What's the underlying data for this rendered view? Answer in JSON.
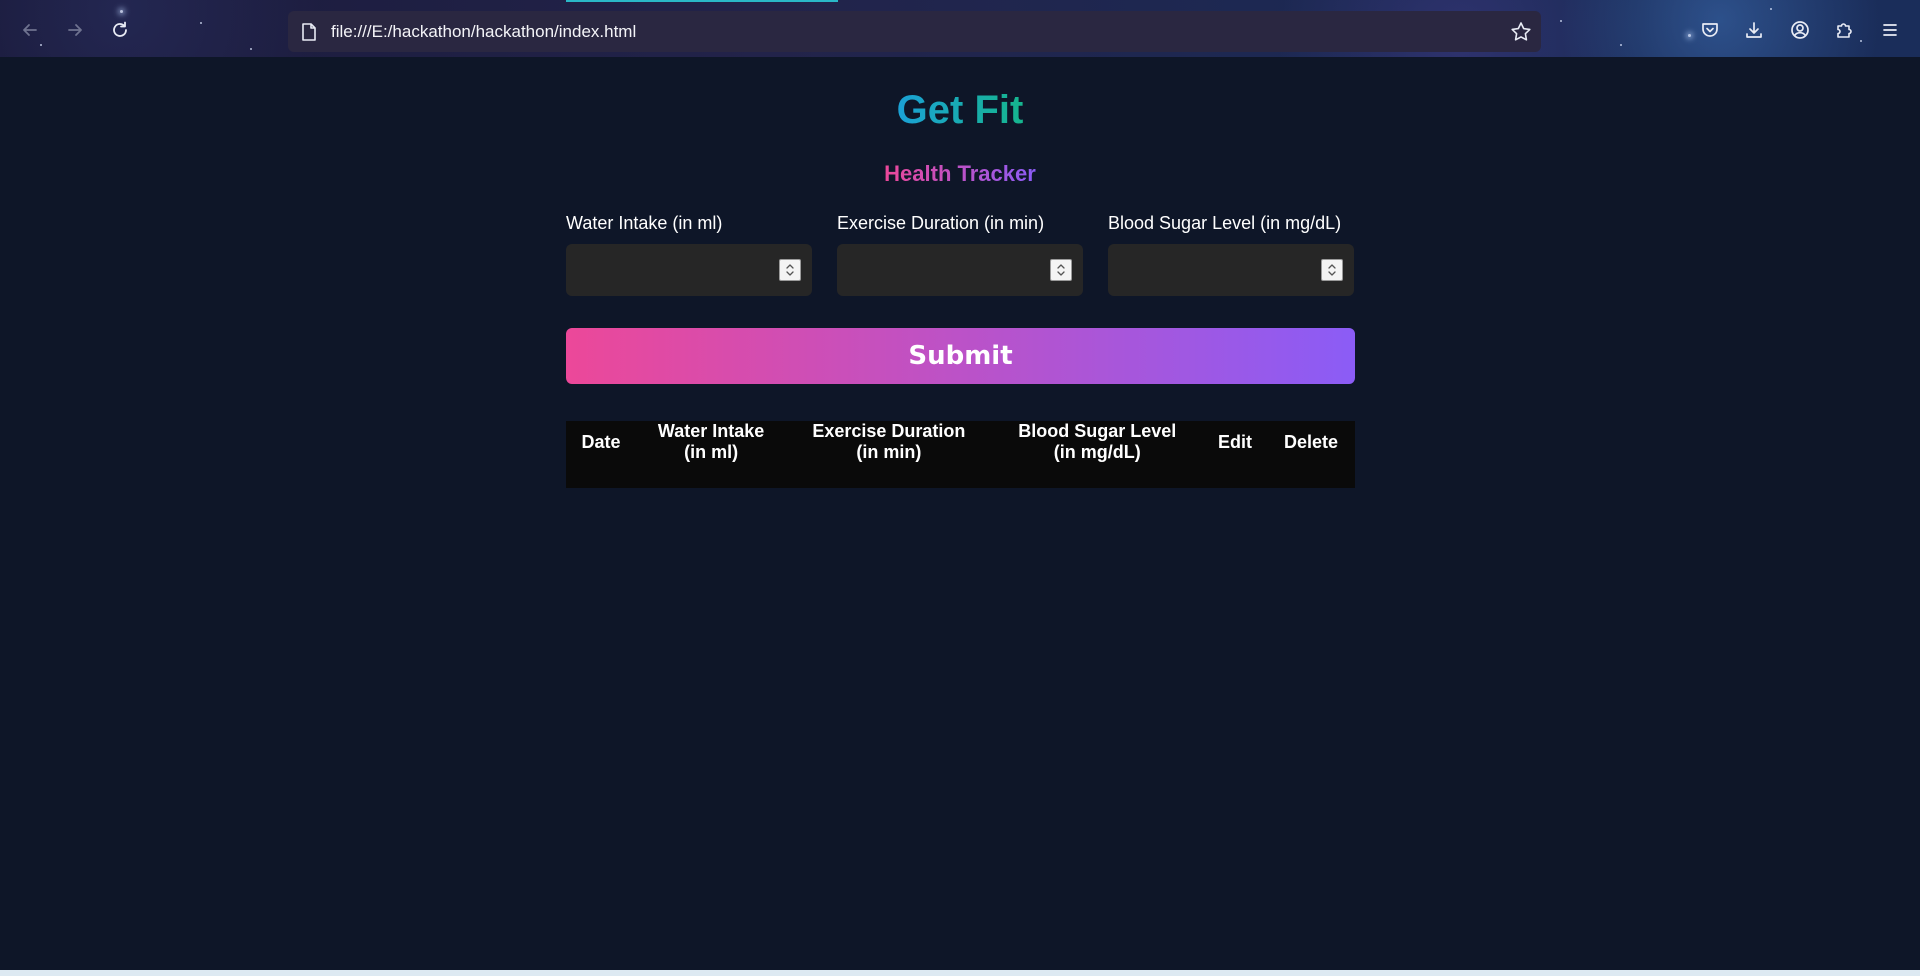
{
  "browser": {
    "url": "file:///E:/hackathon/hackathon/index.html"
  },
  "app": {
    "title": "Get Fit",
    "subtitle": "Health Tracker"
  },
  "form": {
    "water": {
      "label": "Water Intake (in ml)",
      "value": ""
    },
    "exercise": {
      "label": "Exercise Duration (in min)",
      "value": ""
    },
    "sugar": {
      "label": "Blood Sugar Level (in mg/dL)",
      "value": ""
    },
    "submit_label": "Submit"
  },
  "table": {
    "headers": [
      {
        "line1": "Date",
        "line2": ""
      },
      {
        "line1": "Water Intake",
        "line2": "(in ml)"
      },
      {
        "line1": "Exercise Duration",
        "line2": "(in min)"
      },
      {
        "line1": "Blood Sugar Level",
        "line2": "(in mg/dL)"
      },
      {
        "line1": "Edit",
        "line2": ""
      },
      {
        "line1": "Delete",
        "line2": ""
      }
    ],
    "rows": []
  },
  "colors": {
    "title_gradient": [
      "#1ba1d6",
      "#16b58e"
    ],
    "accent_gradient": [
      "#ec4899",
      "#8b5cf6"
    ],
    "page_bg": "#0e1628"
  },
  "icons": {
    "back": "arrow-left-icon",
    "forward": "arrow-right-icon",
    "reload": "reload-icon",
    "page": "page-icon",
    "bookmark": "star-icon",
    "pocket": "pocket-icon",
    "downloads": "download-icon",
    "account": "account-icon",
    "extensions": "extensions-icon",
    "menu": "menu-icon"
  }
}
